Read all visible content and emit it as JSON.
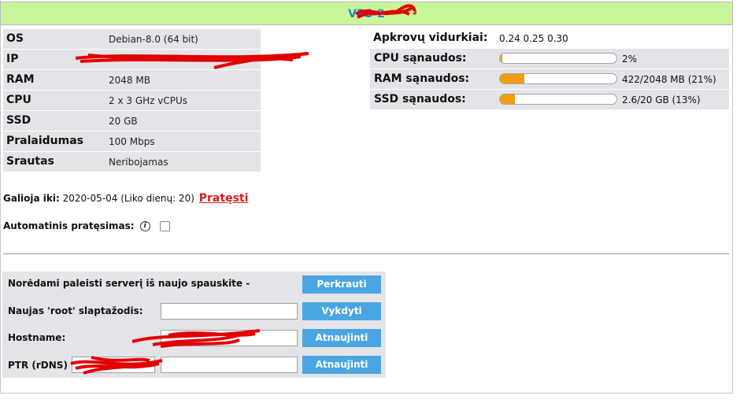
{
  "title": {
    "text": "VPS-2"
  },
  "specs": [
    {
      "key": "OS",
      "value": "Debian-8.0 (64 bit)"
    },
    {
      "key": "IP",
      "value": ""
    },
    {
      "key": "RAM",
      "value": "2048 MB"
    },
    {
      "key": "CPU",
      "value": "2 x 3 GHz vCPUs"
    },
    {
      "key": "SSD",
      "value": "20 GB"
    },
    {
      "key": "Pralaidumas",
      "value": "100 Mbps"
    },
    {
      "key": "Srautas",
      "value": "Neribojamas"
    }
  ],
  "load": {
    "label": "Apkrovų vidurkiai:",
    "value": "0.24 0.25 0.30"
  },
  "usage": [
    {
      "label": "CPU sąnaudos:",
      "value": "2%",
      "fraction": 0.02
    },
    {
      "label": "RAM sąnaudos:",
      "value": "422/2048 MB (21%)",
      "fraction": 0.21
    },
    {
      "label": "SSD sąnaudos:",
      "value": "2.6/20 GB (13%)",
      "fraction": 0.13
    }
  ],
  "expiry": {
    "label": "Galioja iki:",
    "date": "2020-05-04 (Liko dienų: 20)",
    "renew": "Pratęsti"
  },
  "auto_renew": {
    "label": "Automatinis pratęsimas:",
    "checked": false
  },
  "actions": {
    "reinstall_label": "Norėdami paleisti serverį iš naujo spauskite -",
    "reinstall_button": "Perkrauti",
    "root_label": "Naujas 'root' slaptažodis:",
    "root_button": "Vykdyti",
    "hostname_label": "Hostname:",
    "hostname_button": "Atnaujinti",
    "ptr_label": "PTR (rDNS)",
    "ptr_button": "Atnaujinti"
  },
  "colors": {
    "title_bg": "#c9f59a",
    "title_text": "#1e8ad6",
    "bar_fill": "#f39c12",
    "button": "#4aa6e2",
    "renew_link": "#d41c1c",
    "redaction": "#ff0000"
  }
}
